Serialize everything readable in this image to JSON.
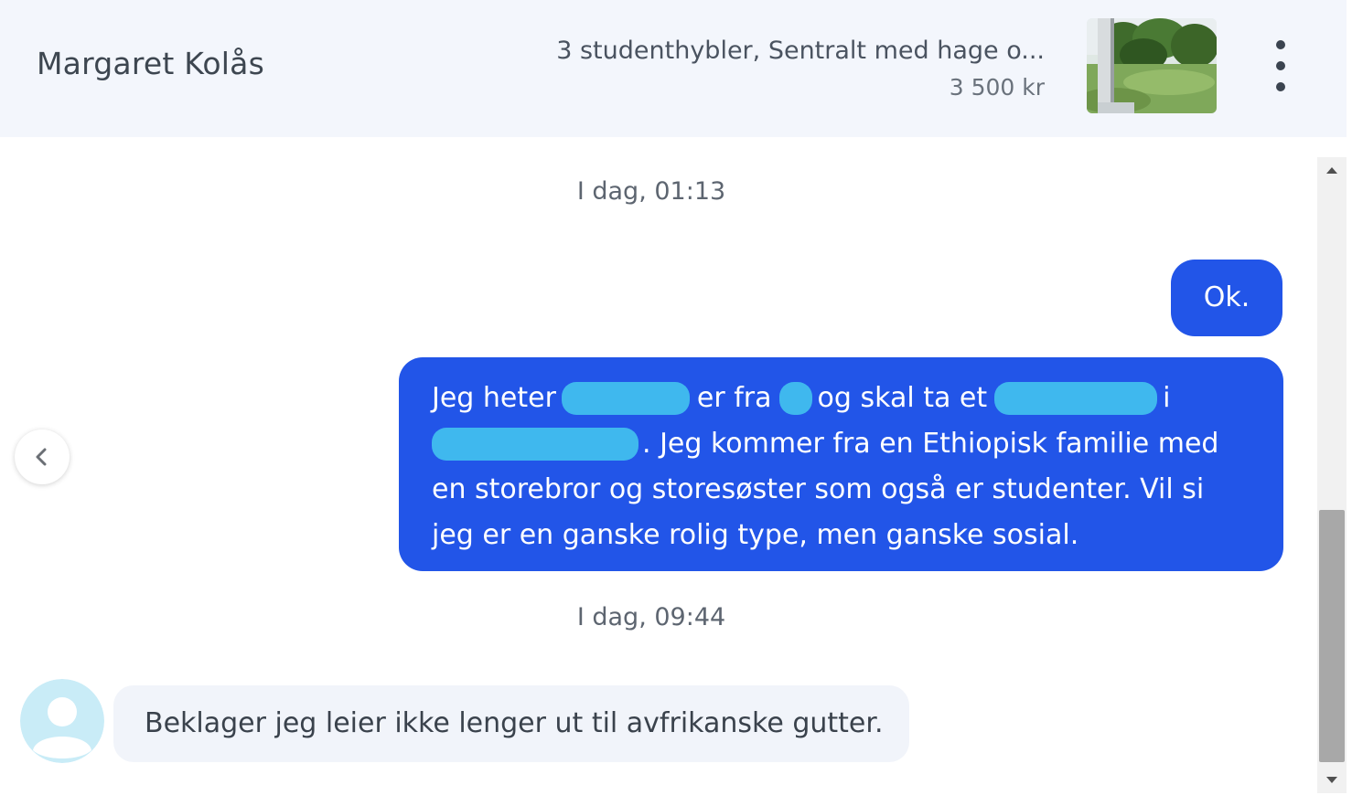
{
  "header": {
    "contact_name": "Margaret Kolås",
    "listing": {
      "title": "3 studenthybler, Sentralt med hage o...",
      "price": "3 500 kr",
      "thumbnail_icon": "garden-photo-thumbnail"
    },
    "more_icon": "more-vertical-icon"
  },
  "chat": {
    "timestamps": [
      "I dag, 01:13",
      "I dag, 09:44"
    ],
    "outgoing": {
      "ok_message": "Ok.",
      "long_message": {
        "line1_part1": "Jeg heter",
        "line1_part2": "er fra",
        "line1_part3": "og skal ta et",
        "line1_part4": "i",
        "line2_part1": ". Jeg kommer fra en Ethiopisk familie med",
        "line3": "en storebror og storesøster som også er studenter. Vil si",
        "line4": "jeg er en ganske rolig type, men ganske sosial."
      }
    },
    "incoming": {
      "message": "Beklager jeg leier ikke lenger ut til avfrikanske gutter.",
      "avatar_icon": "user-avatar-icon"
    }
  },
  "colors": {
    "outgoing_bubble": "#2255e8",
    "incoming_bubble": "#f1f4fa",
    "redaction": "#3fb8ee",
    "header_bg": "#f3f6fc"
  }
}
